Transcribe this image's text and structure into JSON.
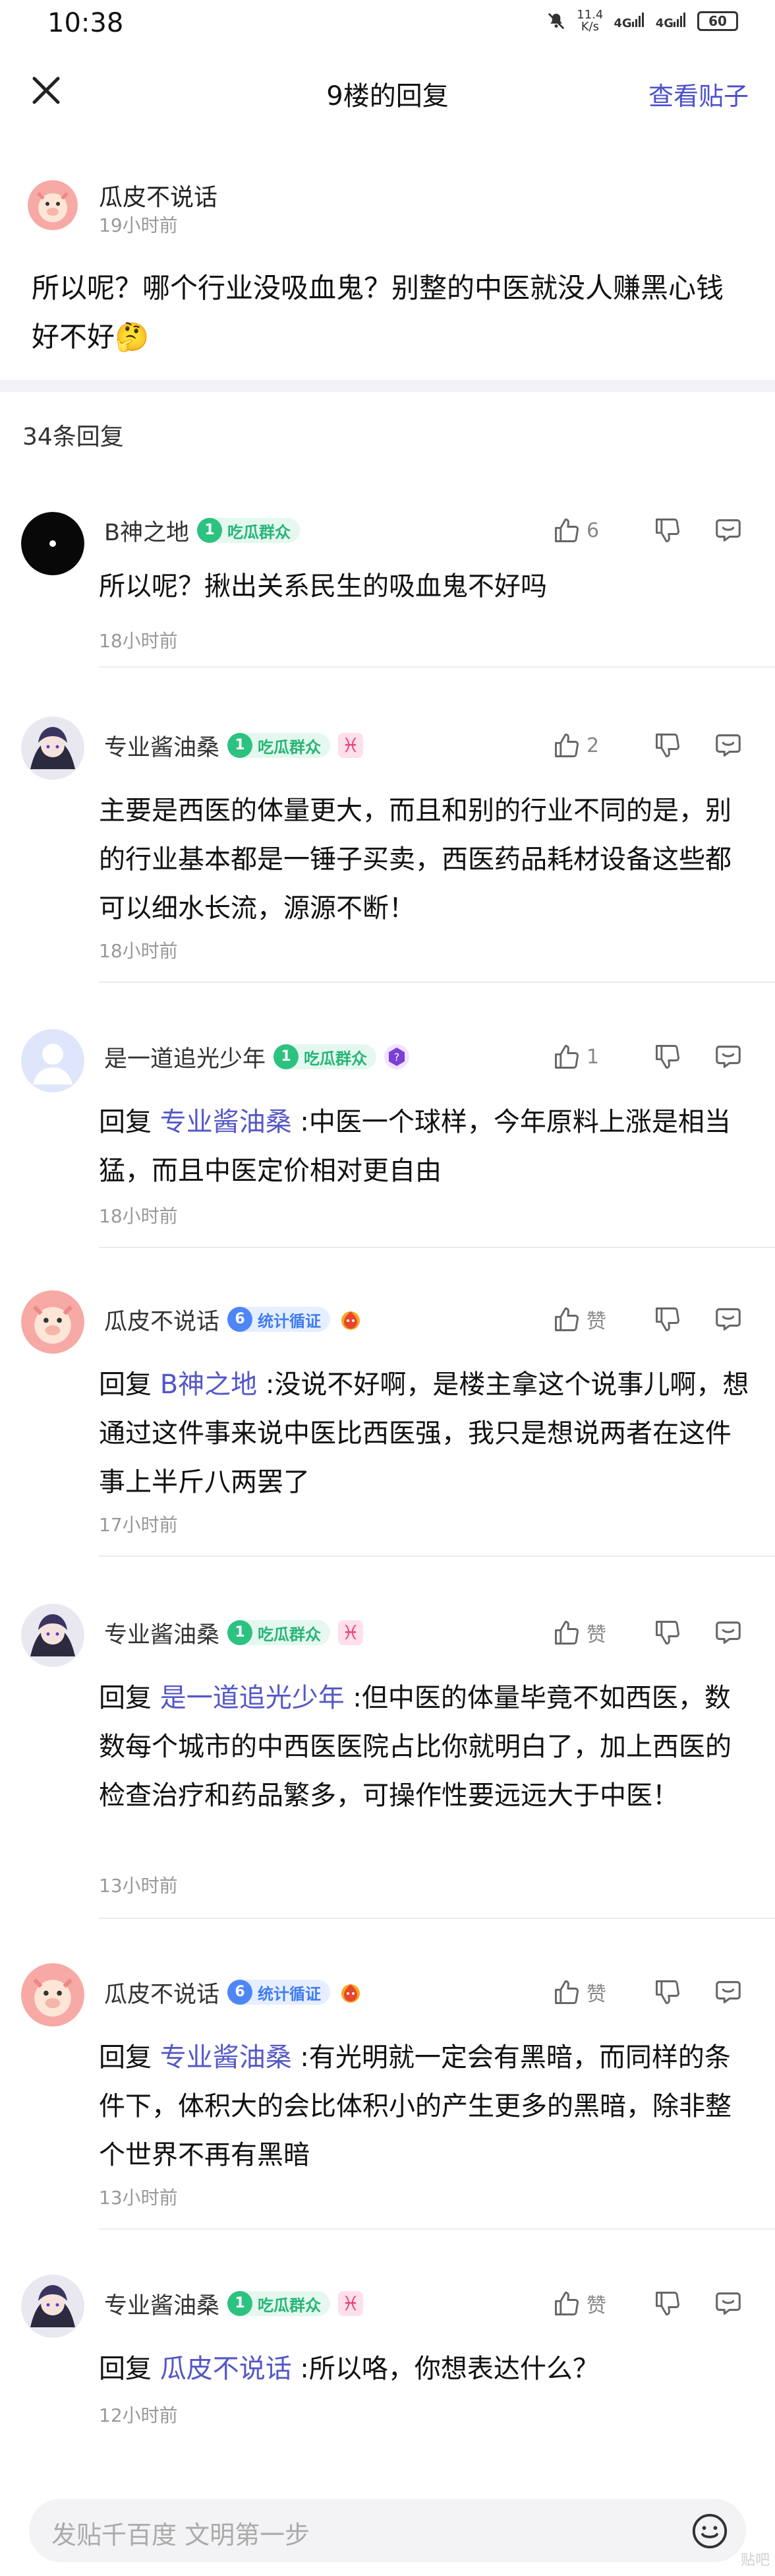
{
  "status": {
    "time": "10:38",
    "speed": "11.4",
    "speed_unit": "K/s",
    "net1": "4G",
    "net2": "4G",
    "battery": "60"
  },
  "header": {
    "title": "9楼的回复",
    "view_post": "查看贴子"
  },
  "post": {
    "author": "瓜皮不说话",
    "time": "19小时前",
    "content": "所以呢？哪个行业没吸血鬼？别整的中医就没人赚黑心钱好不好🤔"
  },
  "reply_count": "34条回复",
  "replies": [
    {
      "name": "B神之地",
      "level": "1",
      "level_title": "吃瓜群众",
      "likes": "6",
      "content": "所以呢？揪出关系民生的吸血鬼不好吗",
      "time": "18小时前"
    },
    {
      "name": "专业酱油桑",
      "level": "1",
      "level_title": "吃瓜群众",
      "badge": "♓",
      "likes": "2",
      "content": "主要是西医的体量更大，而且和别的行业不同的是，别的行业基本都是一锤子买卖，西医药品耗材设备这些都可以细水长流，源源不断！",
      "time": "18小时前"
    },
    {
      "name": "是一道追光少年",
      "level": "1",
      "level_title": "吃瓜群众",
      "likes": "1",
      "prefix": "回复",
      "mention": "专业酱油桑",
      "content": " :中医一个球样，今年原料上涨是相当猛，而且中医定价相对更自由",
      "time": "18小时前"
    },
    {
      "name": "瓜皮不说话",
      "level": "6",
      "level_title": "统计循证",
      "likes": "赞",
      "prefix": "回复",
      "mention": "B神之地",
      "content": " :没说不好啊，是楼主拿这个说事儿啊，想通过这件事来说中医比西医强，我只是想说两者在这件事上半斤八两罢了",
      "time": "17小时前"
    },
    {
      "name": "专业酱油桑",
      "level": "1",
      "level_title": "吃瓜群众",
      "badge": "♓",
      "likes": "赞",
      "prefix": "回复",
      "mention": "是一道追光少年",
      "content": " :但中医的体量毕竟不如西医，数数每个城市的中西医医院占比你就明白了，加上西医的检查治疗和药品繁多，可操作性要远远大于中医！",
      "time": "13小时前"
    },
    {
      "name": "瓜皮不说话",
      "level": "6",
      "level_title": "统计循证",
      "likes": "赞",
      "prefix": "回复",
      "mention": "专业酱油桑",
      "content": " :有光明就一定会有黑暗，而同样的条件下，体积大的会比体积小的产生更多的黑暗，除非整个世界不再有黑暗",
      "time": "13小时前"
    },
    {
      "name": "专业酱油桑",
      "level": "1",
      "level_title": "吃瓜群众",
      "badge": "♓",
      "likes": "赞",
      "prefix": "回复",
      "mention": "瓜皮不说话",
      "content": " :所以咯，你想表达什么？",
      "time": "12小时前"
    }
  ],
  "input": {
    "placeholder": "发贴千百度 文明第一步"
  },
  "watermark": "贴吧"
}
